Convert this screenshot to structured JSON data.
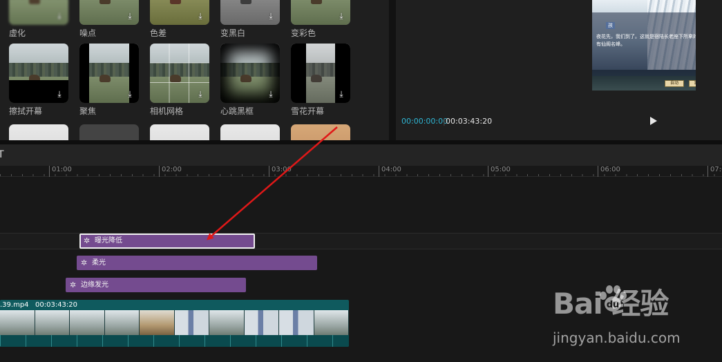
{
  "effects": {
    "row1": [
      {
        "label": "虚化",
        "download_icon": "download-icon"
      },
      {
        "label": "噪点",
        "download_icon": "download-icon"
      },
      {
        "label": "色差",
        "download_icon": "download-icon"
      },
      {
        "label": "变黑白",
        "download_icon": "download-icon"
      },
      {
        "label": "变彩色",
        "download_icon": "download-icon"
      }
    ],
    "row2": [
      {
        "label": "擦拭开幕",
        "download_icon": "download-icon"
      },
      {
        "label": "聚焦",
        "download_icon": "download-icon"
      },
      {
        "label": "相机网格",
        "download_icon": "download-icon"
      },
      {
        "label": "心跳黑框",
        "download_icon": "download-icon"
      },
      {
        "label": "雪花开幕",
        "download_icon": "download-icon"
      }
    ]
  },
  "preview": {
    "dialog_name": "孩",
    "dialog_line1": "夜花先，我们到了。这就是宿陆长老座下所拿的",
    "dialog_line2": "有仙阁名峰。",
    "btn_auto": "自动",
    "btn_skip": "跳过",
    "time_current": "00:00:00:00",
    "time_sep": "|",
    "time_total": "00:03:43:20"
  },
  "timeline": {
    "toolbar_glyph": "T",
    "ruler_ticks": [
      "01:00",
      "02:00",
      "03:00",
      "04:00",
      "05:00",
      "06:00",
      "07:0"
    ],
    "effect_clips": [
      {
        "label": "曝光降低",
        "selected": true
      },
      {
        "label": "柔光",
        "selected": false
      },
      {
        "label": "边缘发光",
        "selected": false
      }
    ],
    "video_clip": {
      "name": ".39.mp4",
      "duration": "00:03:43:20"
    }
  },
  "watermark": {
    "brand": "Bai  经验",
    "url": "jingyan.baidu.com"
  },
  "colors": {
    "accent_time": "#2fb6d4",
    "effect_clip": "#744b8f",
    "video_clip": "#0f5a5e",
    "annotation_arrow": "#e01818"
  }
}
